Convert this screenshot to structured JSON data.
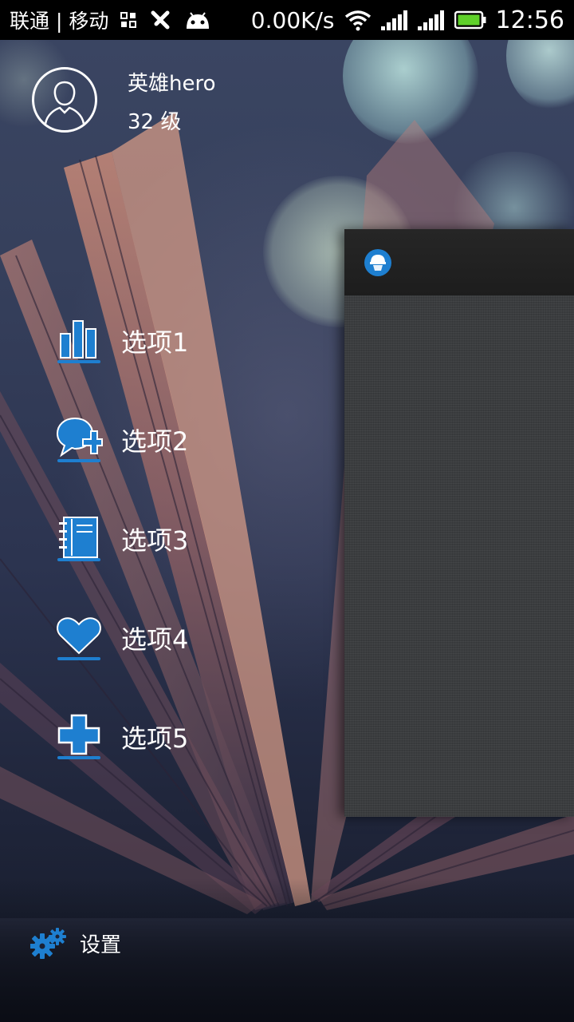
{
  "status_bar": {
    "carrier": "联通 | 移动",
    "speed": "0.00K/s",
    "time": "12:56"
  },
  "profile": {
    "name": "英雄hero",
    "level": "32 级"
  },
  "menu": {
    "items": [
      {
        "label": "选项1",
        "icon": "bar-chart-icon"
      },
      {
        "label": "选项2",
        "icon": "chat-add-icon"
      },
      {
        "label": "选项3",
        "icon": "notebook-icon"
      },
      {
        "label": "选项4",
        "icon": "heart-icon"
      },
      {
        "label": "选项5",
        "icon": "plus-icon"
      }
    ]
  },
  "settings": {
    "label": "设置",
    "icon": "gears-icon"
  },
  "colors": {
    "accent": "#1e7fd0",
    "status_bar": "#000000",
    "content_bar": "#222222",
    "content_body": "#3b3d3f"
  }
}
